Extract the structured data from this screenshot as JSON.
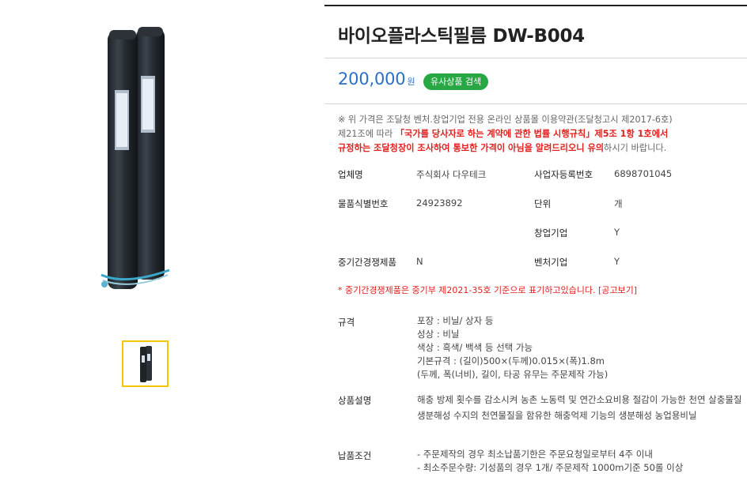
{
  "product": {
    "title": "바이오플라스틱필름 DW-B004",
    "price": "200,000",
    "currency": "원",
    "similar_button": "유사상품 검색"
  },
  "notice": {
    "line1": "※ 위 가격은 조달청 벤처.창업기업 전용 온라인 상품몰 이용약관(조달청고시 제2017-6호)",
    "line2_prefix": "제21조에 따라 ",
    "line2_red": "「국가를 당사자로 하는 계약에 관한 법률 시행규칙」제5조 1항 1호에서",
    "line3_red": "규정하는 조달청장이 조사하여 통보한 가격이 아님을 알려드리오니 유의",
    "line3_suffix": "하시기 바랍니다."
  },
  "info": {
    "company_label": "업체명",
    "company_value": "주식회사 다우테크",
    "bizno_label": "사업자등록번호",
    "bizno_value": "6898701045",
    "itemno_label": "물품식별번호",
    "itemno_value": "24923892",
    "unit_label": "단위",
    "unit_value": "개",
    "startup_label": "창업기업",
    "startup_value": "Y",
    "sme_label": "중기간경쟁제품",
    "sme_value": "N",
    "venture_label": "벤처기업",
    "venture_value": "Y"
  },
  "footnote": {
    "text": "* 중기간경쟁제품은 중기부 제2021-35호 기준으로 표기하고있습니다. ",
    "link": "[공고보기]"
  },
  "spec": {
    "label": "규격",
    "lines": [
      "포장 : 비닐/ 상자 등",
      "성상 : 비닐",
      "색상 : 흑색/ 백색 등 선택 가능",
      "기본규격 : (길이)500×(두께)0.015×(폭)1.8m",
      "(두께, 폭(너비), 길이, 타공 유무는 주문제작 가능)"
    ]
  },
  "description": {
    "label": "상품설명",
    "text": "해충 방제 횟수를 감소시켜 농촌 노동력 및 연간소요비용 절감이 가능한 천연 살충물질 생분해성 수지의 천연물질을 함유한 해충억제 기능의 생분해성 농업용비닐"
  },
  "delivery": {
    "label": "납품조건",
    "lines": [
      "- 주문제작의 경우 최소납품기한은 주문요청일로부터 4주 이내",
      "- 최소주문수량: 기성품의 경우 1개/ 주문제작 1000m기준 50롤 이상"
    ]
  },
  "colors": {
    "price": "#2b6fc6",
    "button": "#27a844",
    "warning": "#e0201f",
    "thumb_border": "#f2c600"
  }
}
